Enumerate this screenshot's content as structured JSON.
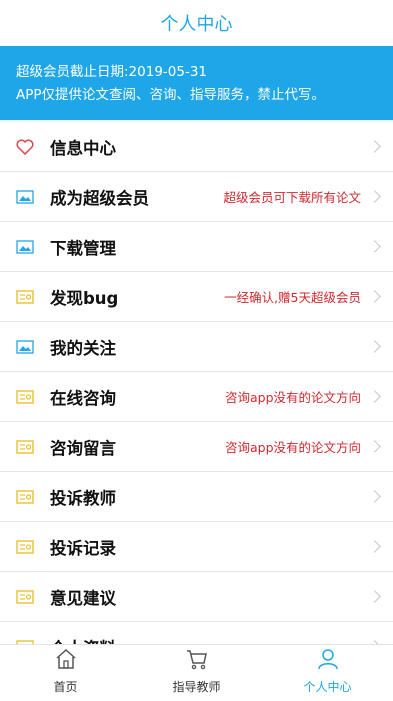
{
  "header": {
    "title": "个人中心"
  },
  "banner": {
    "line1": "超级会员截止日期:2019-05-31",
    "line2": "APP仅提供论文查阅、咨询、指导服务，禁止代写。"
  },
  "menu": [
    {
      "label": "信息中心",
      "note": "",
      "icon": "heart-icon"
    },
    {
      "label": "成为超级会员",
      "note": "超级会员可下载所有论文",
      "icon": "image-icon"
    },
    {
      "label": "下载管理",
      "note": "",
      "icon": "image-icon"
    },
    {
      "label": "发现bug",
      "note": "一经确认,赠5天超级会员",
      "icon": "ticket-icon"
    },
    {
      "label": "我的关注",
      "note": "",
      "icon": "image-icon"
    },
    {
      "label": "在线咨询",
      "note": "咨询app没有的论文方向",
      "icon": "ticket-icon"
    },
    {
      "label": "咨询留言",
      "note": "咨询app没有的论文方向",
      "icon": "ticket-icon"
    },
    {
      "label": "投诉教师",
      "note": "",
      "icon": "ticket-icon"
    },
    {
      "label": "投诉记录",
      "note": "",
      "icon": "ticket-icon"
    },
    {
      "label": "意见建议",
      "note": "",
      "icon": "ticket-icon"
    },
    {
      "label": "个人资料",
      "note": "",
      "icon": "ticket-icon"
    }
  ],
  "tabs": [
    {
      "label": "首页",
      "icon": "home-icon"
    },
    {
      "label": "指导教师",
      "icon": "cart-icon"
    },
    {
      "label": "个人中心",
      "icon": "user-icon"
    }
  ],
  "colors": {
    "accent": "#1fa6e8",
    "note": "#d0282e",
    "heart": "#e0454b",
    "ticket": "#e8c230"
  }
}
